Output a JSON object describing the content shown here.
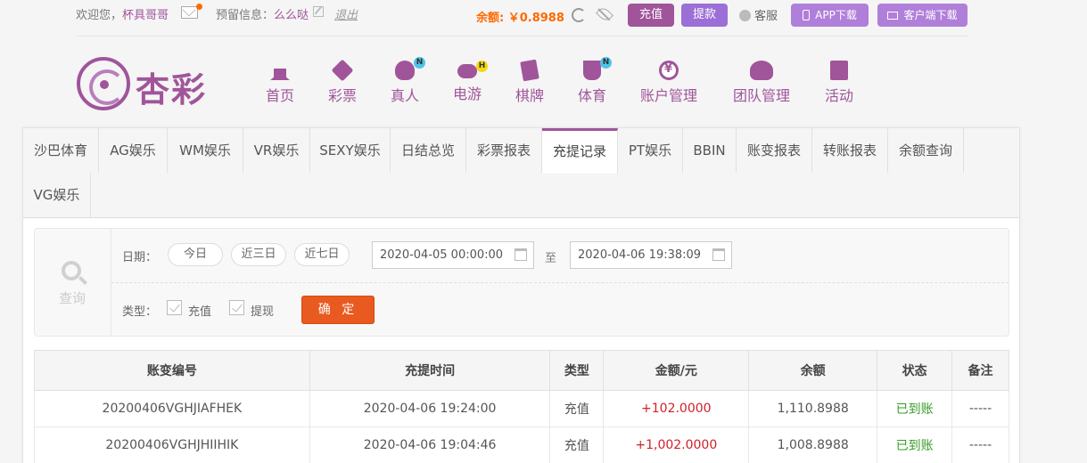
{
  "topbar": {
    "welcome_prefix": "欢迎您，",
    "username": "杯具哥哥",
    "reserve_label": "预留信息：",
    "reserve_value": "么么哒",
    "logout": "退出",
    "balance": "余额: ￥0.8988",
    "recharge": "充值",
    "withdraw": "提款",
    "service": "客服",
    "app_download": "APP下载",
    "client_download": "客户端下载"
  },
  "logo": {
    "text": "杏彩"
  },
  "nav": [
    {
      "label": "首页"
    },
    {
      "label": "彩票"
    },
    {
      "label": "真人",
      "badge": "N"
    },
    {
      "label": "电游",
      "badge": "H"
    },
    {
      "label": "棋牌"
    },
    {
      "label": "体育",
      "badge": "N"
    },
    {
      "label": "账户管理"
    },
    {
      "label": "团队管理"
    },
    {
      "label": "活动"
    }
  ],
  "tabs": [
    "沙巴体育",
    "AG娱乐",
    "WM娱乐",
    "VR娱乐",
    "SEXY娱乐",
    "日结总览",
    "彩票报表",
    "充提记录",
    "PT娱乐",
    "BBIN",
    "账变报表",
    "转账报表",
    "余额查询",
    "VG娱乐"
  ],
  "active_tab": "充提记录",
  "filter": {
    "search_label": "查询",
    "date_label": "日期：",
    "btn_today": "今日",
    "btn_3days": "近三日",
    "btn_7days": "近七日",
    "start_date": "2020-04-05 00:00:00",
    "to_label": "至",
    "end_date": "2020-04-06 19:38:09",
    "type_label": "类型：",
    "type_recharge": "充值",
    "type_withdraw": "提现",
    "confirm": "确 定"
  },
  "table": {
    "headers": [
      "账变编号",
      "充提时间",
      "类型",
      "金额/元",
      "余额",
      "状态",
      "备注"
    ],
    "rows": [
      [
        "20200406VGHJIAFHEK",
        "2020-04-06 19:24:00",
        "充值",
        "+102.0000",
        "1,110.8988",
        "已到账",
        "-----"
      ],
      [
        "20200406VGHJHIIHIK",
        "2020-04-06 19:04:46",
        "充值",
        "+1,002.0000",
        "1,008.8988",
        "已到账",
        "-----"
      ]
    ]
  },
  "colors": {
    "brand": "#a0559a",
    "accent": "#e85a20",
    "amount": "#d0202a",
    "success": "#3a9a2a"
  }
}
